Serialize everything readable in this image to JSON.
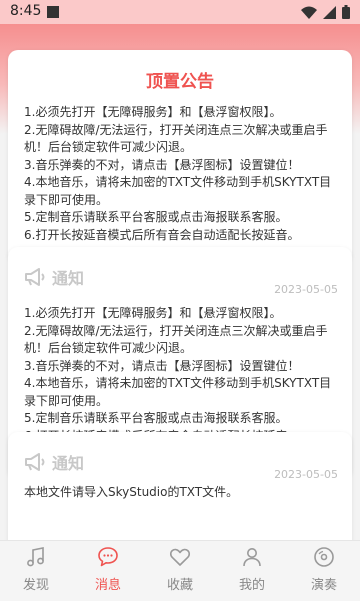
{
  "status_bar": {
    "time": "8:45"
  },
  "pinned": {
    "title": "顶置公告",
    "lines": [
      "1.必须先打开【无障碍服务】和【悬浮窗权限】。",
      "2.无障碍故障/无法运行，打开关闭连点三次解决或重启手",
      "机！后台锁定软件可减少闪退。",
      "3.音乐弹奏的不对，请点击【悬浮图标】设置键位！",
      "4.本地音乐，请将未加密的TXT文件移动到手机SKYTXT目",
      "录下即可使用。",
      "5.定制音乐请联系平台客服或点击海报联系客服。",
      "6.打开长按延音模式后所有音会自动适配长按延音。"
    ]
  },
  "notices": [
    {
      "title": "通知",
      "date": "2023-05-05",
      "lines": [
        "1.必须先打开【无障碍服务】和【悬浮窗权限】。",
        "2.无障碍故障/无法运行，打开关闭连点三次解决或重启手",
        "机！后台锁定软件可减少闪退。",
        "3.音乐弹奏的不对，请点击【悬浮图标】设置键位！",
        "4.本地音乐，请将未加密的TXT文件移动到手机SKYTXT目",
        "录下即可使用。",
        "5.定制音乐请联系平台客服或点击海报联系客服。",
        "6.打开长按延音模式后所有音会自动适配长按延音。"
      ]
    },
    {
      "title": "通知",
      "date": "2023-05-05",
      "lines": [
        "本地文件请导入SkyStudio的TXT文件。"
      ]
    }
  ],
  "nav": {
    "items": [
      {
        "label": "发现",
        "icon": "music-note-icon"
      },
      {
        "label": "消息",
        "icon": "chat-bubble-icon",
        "active": true
      },
      {
        "label": "收藏",
        "icon": "heart-icon"
      },
      {
        "label": "我的",
        "icon": "person-icon"
      },
      {
        "label": "演奏",
        "icon": "disc-icon"
      }
    ]
  },
  "colors": {
    "accent": "#ef5350",
    "header": "#f68f8f"
  }
}
